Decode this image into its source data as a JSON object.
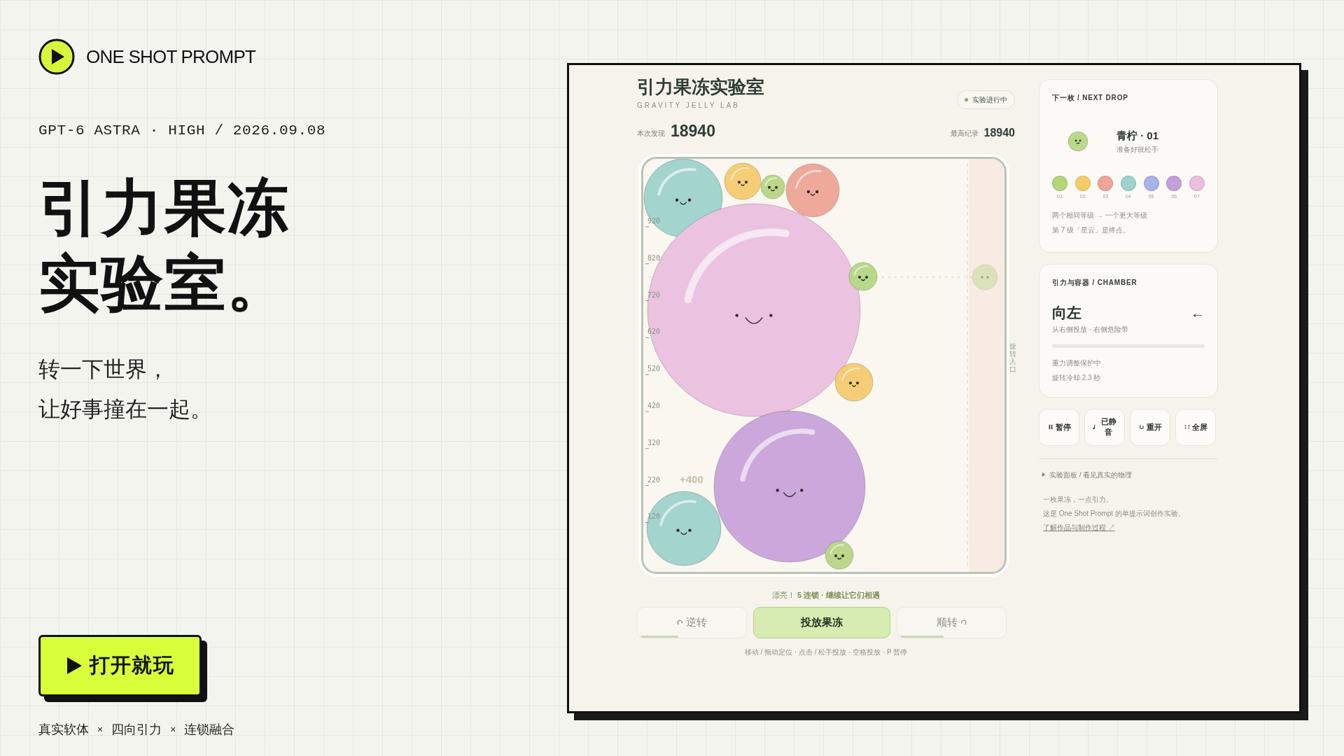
{
  "brand": {
    "name": "ONE SHOT PROMPT"
  },
  "meta": "GPT-6 ASTRA · HIGH / 2026.09.08",
  "headline": [
    "引力果冻",
    "实验室。"
  ],
  "tagline": [
    "转一下世界，",
    "让好事撞在一起。"
  ],
  "cta": {
    "label": "打开就玩"
  },
  "features": [
    "真实软体",
    "×",
    "四向引力",
    "×",
    "连锁融合"
  ],
  "game": {
    "title": "引力果冻实验室",
    "subtitle": "GRAVITY JELLY LAB",
    "status": "实验进行中",
    "score": {
      "label": "本次发现",
      "value": "18940"
    },
    "best": {
      "label": "最高纪录",
      "value": "18940"
    },
    "board": {
      "axis_labels": [
        "920",
        "820",
        "720",
        "620",
        "520",
        "420",
        "320",
        "220",
        "120"
      ],
      "score_popup": "+400",
      "entry_label": "旋转入口"
    },
    "message": "漂亮！ **5 连锁 · 继续让它们相遇**",
    "controls": [
      {
        "kind": "rotate-left",
        "label": "逆转",
        "level": 0.35
      },
      {
        "kind": "drop",
        "label": "投放果冻"
      },
      {
        "kind": "rotate-right",
        "label": "顺转",
        "level": 0.4
      }
    ],
    "keys_hint": "移动 / 拖动定位 · 点击 / 松手投放 · 空格投放 · P 暂停"
  },
  "next_card": {
    "heading": "下一枚 / NEXT DROP",
    "name": "青柠 · 01",
    "note": "准备好就松手",
    "levels": [
      {
        "label": "01",
        "color": "#b5d57a"
      },
      {
        "label": "02",
        "color": "#f5cc6c"
      },
      {
        "label": "03",
        "color": "#eea496"
      },
      {
        "label": "04",
        "color": "#9fd2cb"
      },
      {
        "label": "05",
        "color": "#a7b3ea"
      },
      {
        "label": "06",
        "color": "#c3a0da"
      },
      {
        "label": "07",
        "color": "#ebbede"
      }
    ],
    "rules": [
      "两个相同等级 → 一个更大等级",
      "第 7 级「星云」是终点。"
    ]
  },
  "chamber_card": {
    "heading": "引力与容器 / CHAMBER",
    "direction": "向左",
    "arrow": "←",
    "detail": "从右侧投放 · 右侧危险带",
    "notes": [
      "重力调整保护中",
      "旋转冷却 2.3 秒"
    ]
  },
  "toolbar": [
    {
      "kind": "pause",
      "label": "暂停"
    },
    {
      "kind": "sound",
      "label": "已静音"
    },
    {
      "kind": "restart",
      "label": "重开"
    },
    {
      "kind": "fullscreen",
      "label": "全屏"
    }
  ],
  "panel_toggle": {
    "label": "实验面板 / 看见真实的物理",
    "expanded": false
  },
  "about": {
    "lines": [
      "一枚果冻，一点引力。",
      "这是 One Shot Prompt 的单提示词创作实验。"
    ],
    "link": "了解作品与制作过程 ↗"
  }
}
